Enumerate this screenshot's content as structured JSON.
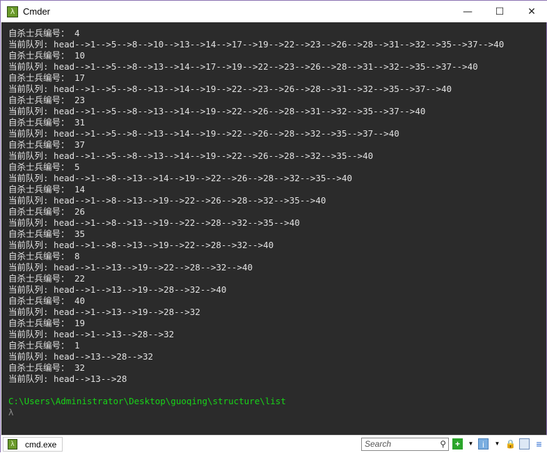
{
  "window": {
    "title": "Cmder",
    "app_icon": "lambda-icon",
    "minimize": "—",
    "maximize": "☐",
    "close": "✕"
  },
  "terminal": {
    "lines": [
      "自杀士兵编号： 4",
      "当前队列: head-->1-->5-->8-->10-->13-->14-->17-->19-->22-->23-->26-->28-->31-->32-->35-->37-->40",
      "自杀士兵编号： 10",
      "当前队列: head-->1-->5-->8-->13-->14-->17-->19-->22-->23-->26-->28-->31-->32-->35-->37-->40",
      "自杀士兵编号： 17",
      "当前队列: head-->1-->5-->8-->13-->14-->19-->22-->23-->26-->28-->31-->32-->35-->37-->40",
      "自杀士兵编号： 23",
      "当前队列: head-->1-->5-->8-->13-->14-->19-->22-->26-->28-->31-->32-->35-->37-->40",
      "自杀士兵编号： 31",
      "当前队列: head-->1-->5-->8-->13-->14-->19-->22-->26-->28-->32-->35-->37-->40",
      "自杀士兵编号： 37",
      "当前队列: head-->1-->5-->8-->13-->14-->19-->22-->26-->28-->32-->35-->40",
      "自杀士兵编号： 5",
      "当前队列: head-->1-->8-->13-->14-->19-->22-->26-->28-->32-->35-->40",
      "自杀士兵编号： 14",
      "当前队列: head-->1-->8-->13-->19-->22-->26-->28-->32-->35-->40",
      "自杀士兵编号： 26",
      "当前队列: head-->1-->8-->13-->19-->22-->28-->32-->35-->40",
      "自杀士兵编号： 35",
      "当前队列: head-->1-->8-->13-->19-->22-->28-->32-->40",
      "自杀士兵编号： 8",
      "当前队列: head-->1-->13-->19-->22-->28-->32-->40",
      "自杀士兵编号： 22",
      "当前队列: head-->1-->13-->19-->28-->32-->40",
      "自杀士兵编号： 40",
      "当前队列: head-->1-->13-->19-->28-->32",
      "自杀士兵编号： 19",
      "当前队列: head-->1-->13-->28-->32",
      "自杀士兵编号： 1",
      "当前队列: head-->13-->28-->32",
      "自杀士兵编号： 32",
      "当前队列: head-->13-->28"
    ],
    "cwd": "C:\\Users\\Administrator\\Desktop\\guoqing\\structure\\list",
    "prompt": "λ",
    "colors": {
      "background": "#2b2b2b",
      "text": "#e2e2e2",
      "path": "#18d418"
    }
  },
  "statusbar": {
    "tab_label": "cmd.exe",
    "search_placeholder": "Search",
    "icons": [
      "plus-icon",
      "dropdown-icon",
      "monitor-icon",
      "dropdown-icon",
      "lock-icon",
      "panel-icon",
      "menu-icon"
    ]
  }
}
